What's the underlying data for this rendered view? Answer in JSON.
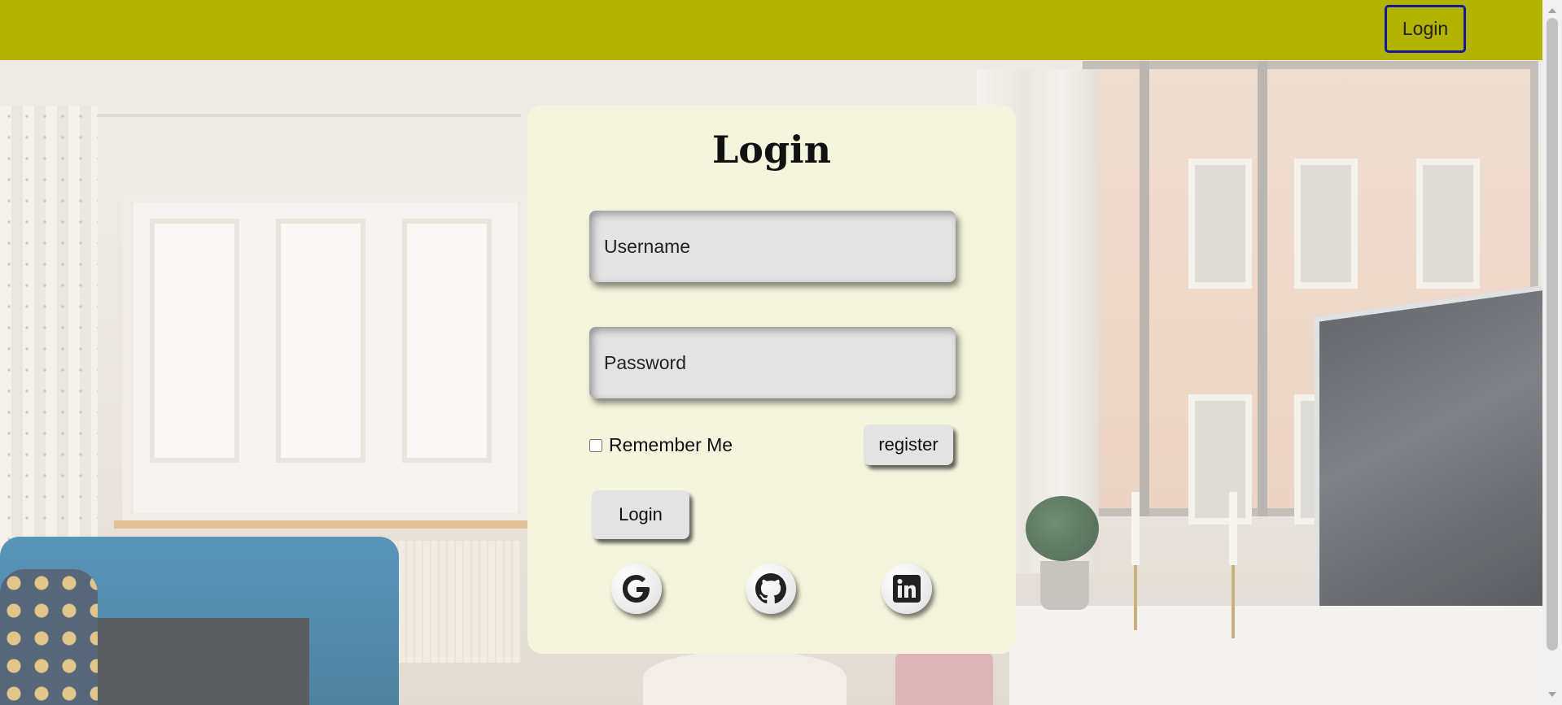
{
  "header": {
    "login_label": "Login"
  },
  "card": {
    "title": "Login",
    "username_placeholder": "Username",
    "password_placeholder": "Password",
    "remember_label": "Remember Me",
    "register_label": "register",
    "login_label": "Login"
  },
  "social": [
    {
      "name": "google-icon"
    },
    {
      "name": "github-icon"
    },
    {
      "name": "linkedin-icon"
    }
  ],
  "colors": {
    "topbar": "#b2b300",
    "card_background": "#f5f4dc",
    "nav_button_border": "#14189a",
    "field_background": "#e3e3e3"
  }
}
